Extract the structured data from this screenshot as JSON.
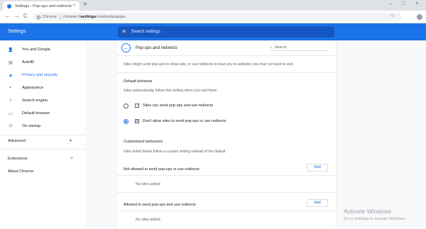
{
  "browser": {
    "tab_title": "Settings - Pop-ups and redirects",
    "tab_close": "×",
    "new_tab": "+",
    "win_min": "–",
    "win_max": "□",
    "win_close": "×",
    "back": "←",
    "forward": "→",
    "reload": "C",
    "site_chip": "Chrome",
    "url_prefix": "chrome://",
    "url_bold": "settings",
    "url_rest": "/content/popups",
    "star": "☆",
    "menu": "⋮"
  },
  "header": {
    "title": "Settings",
    "search_placeholder": "Search settings",
    "search_icon": "🔍"
  },
  "sidebar": {
    "items": [
      {
        "label": "You and Google",
        "icon": "person-icon",
        "glyph": "👤"
      },
      {
        "label": "Autofill",
        "icon": "clipboard-icon",
        "glyph": "▤"
      },
      {
        "label": "Privacy and security",
        "icon": "shield-icon",
        "glyph": "◈"
      },
      {
        "label": "Appearance",
        "icon": "palette-icon",
        "glyph": "◐"
      },
      {
        "label": "Search engine",
        "icon": "search-icon",
        "glyph": "⌕"
      },
      {
        "label": "Default browser",
        "icon": "browser-icon",
        "glyph": "▭"
      },
      {
        "label": "On startup",
        "icon": "power-icon",
        "glyph": "⏻"
      }
    ],
    "advanced": "Advanced",
    "advanced_arrow": "▾",
    "extensions": "Extensions",
    "extensions_icon": "↗",
    "about": "About Chrome"
  },
  "page": {
    "title": "Pop-ups and redirects",
    "back_glyph": "←",
    "search_placeholder": "Search",
    "search_glyph": "⌕",
    "intro": "Sites might send pop-ups to show ads, or use redirects to lead you to websites you may not want to visit",
    "default_heading": "Default behavior",
    "default_desc": "Sites automatically follow this setting when you visit them",
    "options": [
      {
        "label": "Sites can send pop-ups and use redirects",
        "selected": false,
        "glyph": "↗"
      },
      {
        "label": "Don't allow sites to send pop-ups or use redirects",
        "selected": true,
        "glyph": "⊠"
      }
    ],
    "custom_heading": "Customized behaviors",
    "custom_desc": "Sites listed below follow a custom setting instead of the default",
    "lists": [
      {
        "label": "Not allowed to send pop-ups or use redirects",
        "add": "Add",
        "empty": "No sites added"
      },
      {
        "label": "Allowed to send pop-ups and use redirects",
        "add": "Add",
        "empty": "No sites added"
      }
    ]
  },
  "watermark": {
    "line1": "Activate Windows",
    "line2": "Go to Settings to activate Windows."
  },
  "colors": {
    "accent": "#1a73e8",
    "header_bg": "#1a73e8",
    "search_bg": "#1557c0"
  }
}
